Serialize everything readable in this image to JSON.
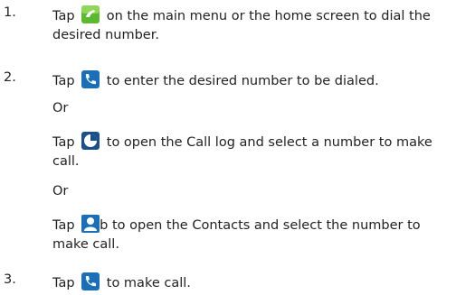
{
  "steps": [
    {
      "number": "1.",
      "pre": "Tap",
      "icon": "phone-app-icon",
      "post": "on the main menu or the home screen to dial the",
      "cont": "desired number."
    },
    {
      "number": "2.",
      "pre": "Tap",
      "icon": "dialer-icon",
      "post": "to enter the desired number to be dialed.",
      "or1": "Or",
      "alt1_pre": "Tap",
      "alt1_icon": "call-log-icon",
      "alt1_post": "to open the Call log and select a number to make",
      "alt1_cont": "call.",
      "or2": "Or",
      "alt2_pre": "Tap",
      "alt2_icon": "contacts-icon",
      "alt2_post": "b to open the Contacts and select the number to",
      "alt2_cont": "make call."
    },
    {
      "number": "3.",
      "pre": "Tap",
      "icon": "dialer-icon",
      "post": "to make call."
    }
  ],
  "colors": {
    "text": "#222222",
    "phone_green": "#5cb82e",
    "icon_blue": "#1b6fb8"
  }
}
